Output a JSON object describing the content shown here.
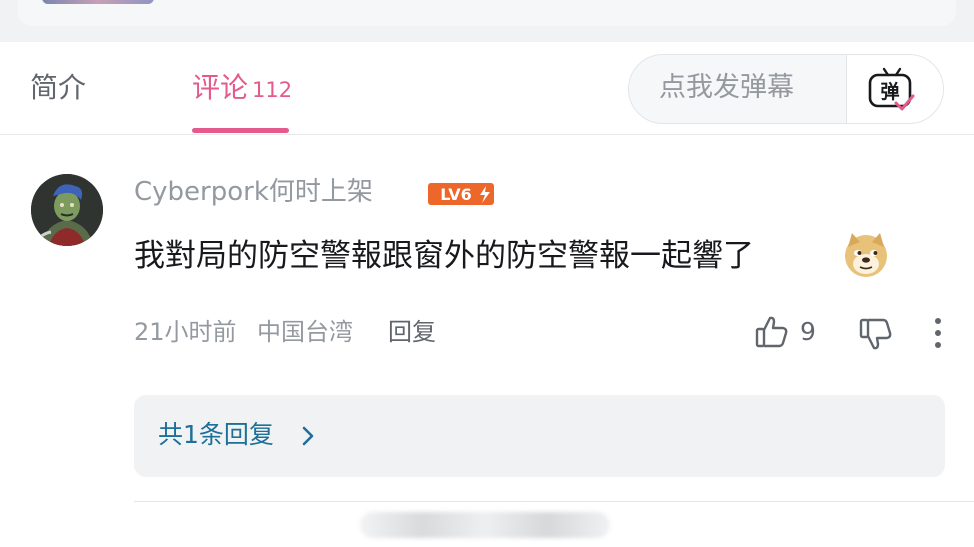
{
  "tabs": {
    "intro_label": "简介",
    "comments_label": "评论",
    "comments_count": "112"
  },
  "danmaku": {
    "placeholder": "点我发弹幕",
    "button_glyph": "弹"
  },
  "comment": {
    "username": "Cyberpork何时上架",
    "level": "LV6",
    "text": "我對局的防空警報跟窗外的防空警報一起響了",
    "emoji": "doge-emoji",
    "time": "21小时前",
    "location": "中国台湾",
    "reply_label": "回复",
    "like_count": "9"
  },
  "replies": {
    "label": "共1条回复"
  },
  "colors": {
    "accent_pink": "#e45a8c",
    "link_blue": "#1e6f99",
    "muted_gray": "#9499a0",
    "text_dark": "#18191c"
  }
}
